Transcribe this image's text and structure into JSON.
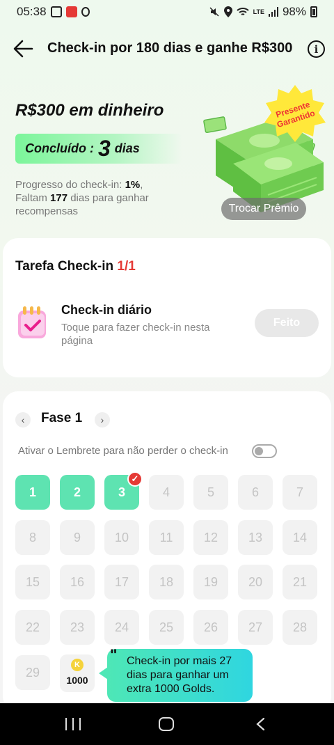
{
  "status_bar": {
    "time": "05:38",
    "network": "LTE",
    "battery": "98%"
  },
  "header": {
    "title": "Check-in por 180 dias e ganhe R$300",
    "info_label": "i"
  },
  "reward": {
    "title": "R$300 em dinheiro",
    "completed_label": "Concluído :",
    "completed_count": "3",
    "completed_unit": "dias",
    "progress_prefix": "Progresso do check-in: ",
    "progress_value": "1%",
    "progress_suffix": ",",
    "remaining_prefix": "Faltam ",
    "remaining_days": "177",
    "remaining_suffix": " dias para ganhar recompensas",
    "badge_text": "Presente Garantido",
    "exchange_button": "Trocar Prêmio"
  },
  "task": {
    "title": "Tarefa Check-in ",
    "count": "1/1",
    "daily_title": "Check-in diário",
    "daily_description": "Toque para fazer check-in nesta página",
    "done_button": "Feito"
  },
  "phase": {
    "label": "Fase 1",
    "prev_icon": "chevron-left-icon",
    "next_icon": "chevron-right-icon",
    "reminder_text": "Ativar o Lembrete para não perder o check-in",
    "reminder_enabled": false,
    "days": [
      {
        "label": "1",
        "checked": true
      },
      {
        "label": "2",
        "checked": true
      },
      {
        "label": "3",
        "checked": true
      },
      {
        "label": "4",
        "checked": false
      },
      {
        "label": "5",
        "checked": false
      },
      {
        "label": "6",
        "checked": false
      },
      {
        "label": "7",
        "checked": false
      },
      {
        "label": "8",
        "checked": false
      },
      {
        "label": "9",
        "checked": false
      },
      {
        "label": "10",
        "checked": false
      },
      {
        "label": "11",
        "checked": false
      },
      {
        "label": "12",
        "checked": false
      },
      {
        "label": "13",
        "checked": false
      },
      {
        "label": "14",
        "checked": false
      },
      {
        "label": "15",
        "checked": false
      },
      {
        "label": "16",
        "checked": false
      },
      {
        "label": "17",
        "checked": false
      },
      {
        "label": "18",
        "checked": false
      },
      {
        "label": "19",
        "checked": false
      },
      {
        "label": "20",
        "checked": false
      },
      {
        "label": "21",
        "checked": false
      },
      {
        "label": "22",
        "checked": false
      },
      {
        "label": "23",
        "checked": false
      },
      {
        "label": "24",
        "checked": false
      },
      {
        "label": "25",
        "checked": false
      },
      {
        "label": "26",
        "checked": false
      },
      {
        "label": "27",
        "checked": false
      },
      {
        "label": "28",
        "checked": false
      },
      {
        "label": "29",
        "checked": false
      }
    ],
    "bonus_coin_label": "K",
    "bonus_amount": "1000",
    "tooltip_quote": "\"",
    "tooltip_text": "Check-in por mais 27 dias para ganhar um extra 1000 Golds."
  },
  "colors": {
    "checked_day": "#5ee3b1",
    "accent_red": "#e53935",
    "tooltip_start": "#4ee7b6",
    "tooltip_end": "#2fd6e0"
  }
}
